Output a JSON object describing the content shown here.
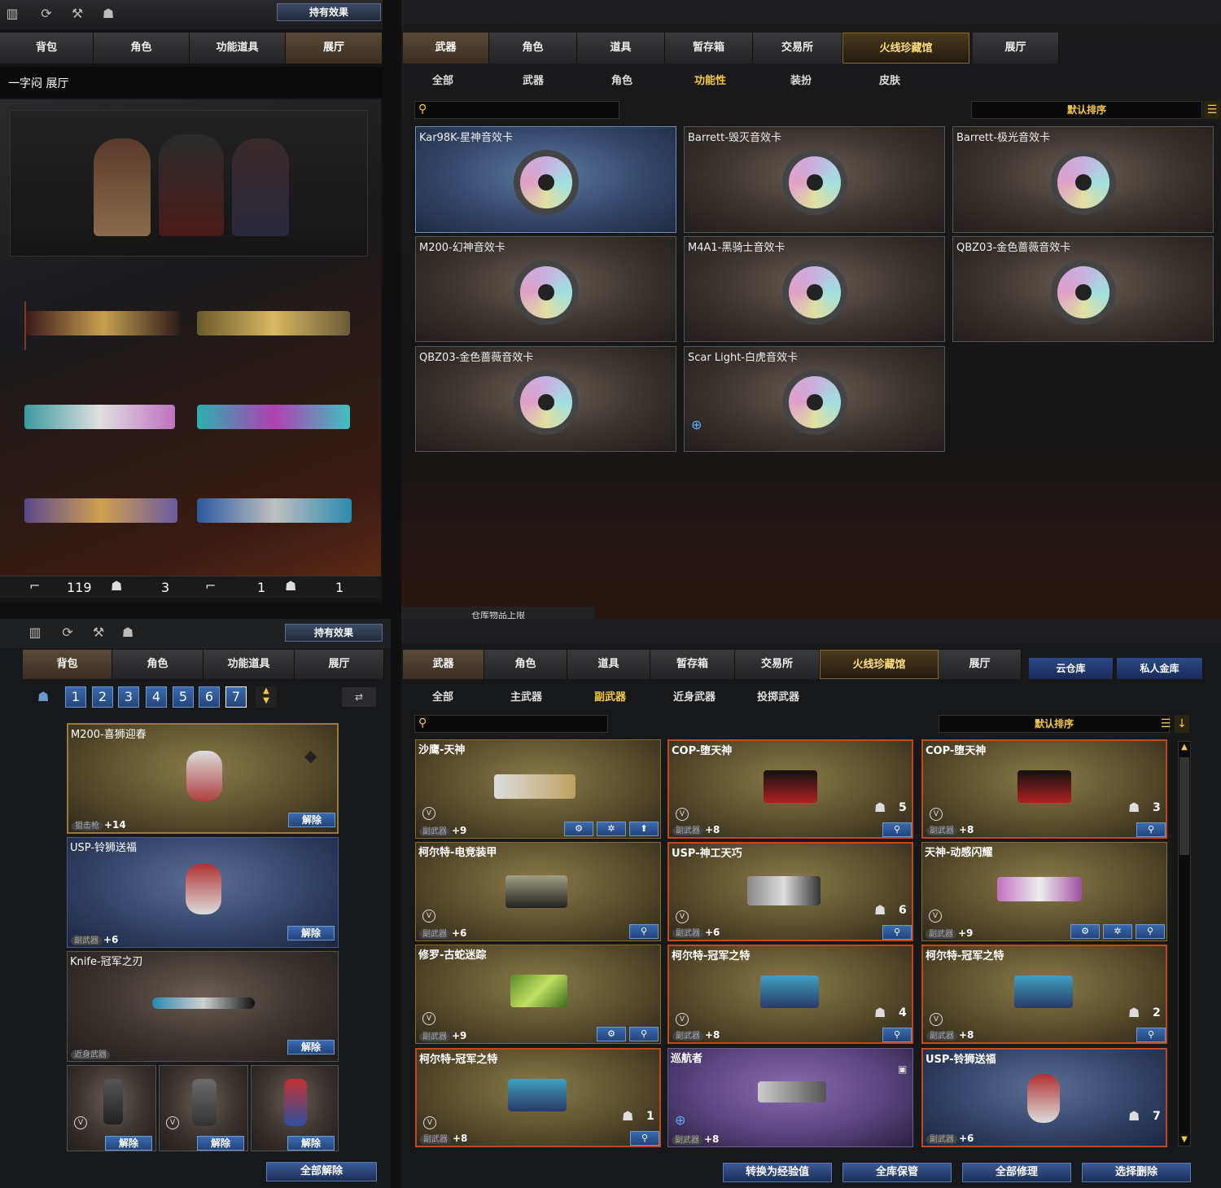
{
  "top_left": {
    "effects_btn": "持有效果",
    "tabs": [
      "背包",
      "角色",
      "功能道具",
      "展厅"
    ],
    "hall_title": "一字闷 展厅",
    "stats": [
      "119",
      "3",
      "1",
      "1"
    ]
  },
  "top_right": {
    "tabs": [
      "武器",
      "角色",
      "道具",
      "暂存箱",
      "交易所",
      "火线珍藏馆",
      "展厅"
    ],
    "subtabs": [
      "全部",
      "武器",
      "角色",
      "功能性",
      "装扮",
      "皮肤"
    ],
    "sort_label": "默认排序",
    "cards": [
      "Kar98K-星神音效卡",
      "Barrett-毁灭音效卡",
      "Barrett-极光音效卡",
      "M200-幻神音效卡",
      "M4A1-黑骑士音效卡",
      "QBZ03-金色蔷薇音效卡",
      "QBZ03-金色蔷薇音效卡",
      "Scar Light-白虎音效卡"
    ],
    "footer_label": "仓库物品上限"
  },
  "bottom_left": {
    "effects_btn": "持有效果",
    "tabs": [
      "背包",
      "角色",
      "功能道具",
      "展厅"
    ],
    "pages": [
      "1",
      "2",
      "3",
      "4",
      "5",
      "6",
      "7"
    ],
    "items": [
      {
        "name": "M200-喜狮迎春",
        "cat": "狙击枪",
        "lvl": "+14"
      },
      {
        "name": "USP-铃狮送福",
        "cat": "副武器",
        "lvl": "+6"
      },
      {
        "name": "Knife-冠军之刃",
        "cat": "近身武器",
        "lvl": ""
      }
    ],
    "release": "解除",
    "release_all": "全部解除"
  },
  "bottom_right": {
    "tabs": [
      "武器",
      "角色",
      "道具",
      "暂存箱",
      "交易所",
      "火线珍藏馆",
      "展厅"
    ],
    "side_tabs": [
      "云仓库",
      "私人金库"
    ],
    "subtabs": [
      "全部",
      "主武器",
      "副武器",
      "近身武器",
      "投掷武器"
    ],
    "sort_label": "默认排序",
    "cards": [
      {
        "name": "沙鹰-天神",
        "cat": "副武器",
        "lvl": "+9",
        "count": ""
      },
      {
        "name": "COP-堕天神",
        "cat": "副武器",
        "lvl": "+8",
        "count": "5"
      },
      {
        "name": "COP-堕天神",
        "cat": "副武器",
        "lvl": "+8",
        "count": "3"
      },
      {
        "name": "柯尔特-电竞装甲",
        "cat": "副武器",
        "lvl": "+6",
        "count": ""
      },
      {
        "name": "USP-神工天巧",
        "cat": "副武器",
        "lvl": "+6",
        "count": "6"
      },
      {
        "name": "天神-动感闪耀",
        "cat": "副武器",
        "lvl": "+9",
        "count": ""
      },
      {
        "name": "修罗-古蛇迷踪",
        "cat": "副武器",
        "lvl": "+9",
        "count": ""
      },
      {
        "name": "柯尔特-冠军之特",
        "cat": "副武器",
        "lvl": "+8",
        "count": "4"
      },
      {
        "name": "柯尔特-冠军之特",
        "cat": "副武器",
        "lvl": "+8",
        "count": "2"
      },
      {
        "name": "柯尔特-冠军之特",
        "cat": "副武器",
        "lvl": "+8",
        "count": "1"
      },
      {
        "name": "巡航者",
        "cat": "副武器",
        "lvl": "+8",
        "count": ""
      },
      {
        "name": "USP-铃狮送福",
        "cat": "副武器",
        "lvl": "+6",
        "count": "7"
      }
    ],
    "buttons": [
      "转换为经验值",
      "全库保管",
      "全部修理",
      "选择删除"
    ]
  }
}
